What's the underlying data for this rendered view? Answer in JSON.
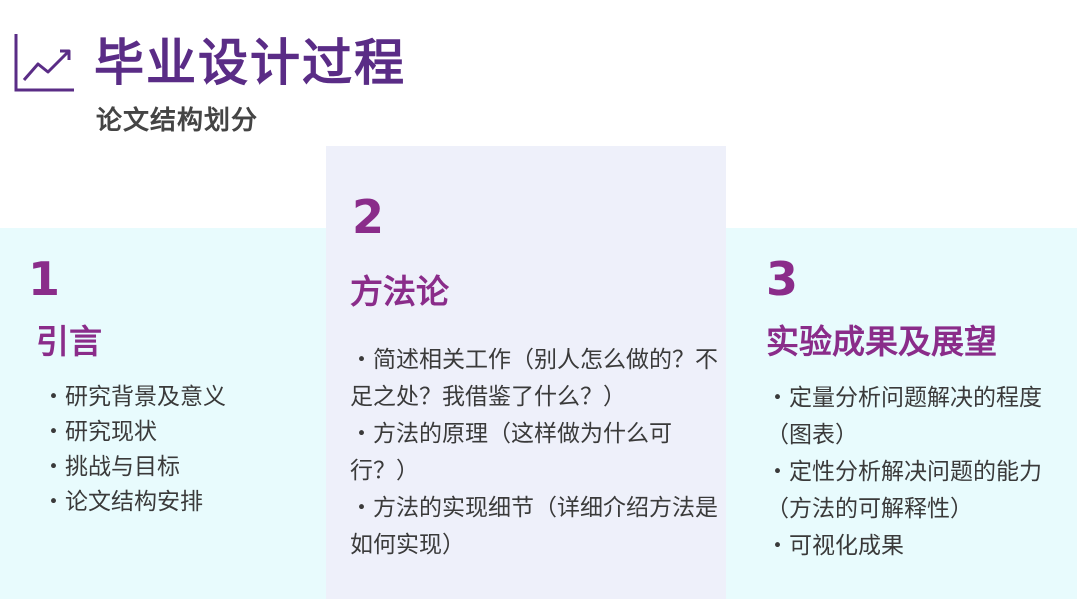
{
  "header": {
    "title": "毕业设计过程",
    "subtitle": "论文结构划分",
    "icon": "trend-line-chart-icon"
  },
  "colors": {
    "title": "#5a2c86",
    "accent": "#8a2c8a",
    "panel_light_cyan": "#e8fbfd",
    "panel_light_lavender": "#eef0fa",
    "body_text": "#3a3a3a"
  },
  "columns": [
    {
      "number": "1",
      "heading": "引言",
      "items": [
        "・研究背景及意义",
        "・研究现状",
        "・挑战与目标",
        "・论文结构安排"
      ]
    },
    {
      "number": "2",
      "heading": "方法论",
      "items": [
        "・简述相关工作（别人怎么做的？不足之处？我借鉴了什么？）",
        "・方法的原理（这样做为什么可行？）",
        "・方法的实现细节（详细介绍方法是如何实现）"
      ]
    },
    {
      "number": "3",
      "heading": "实验成果及展望",
      "items": [
        "・定量分析问题解决的程度（图表）",
        "・定性分析解决问题的能力（方法的可解释性）",
        "・可视化成果"
      ]
    }
  ]
}
